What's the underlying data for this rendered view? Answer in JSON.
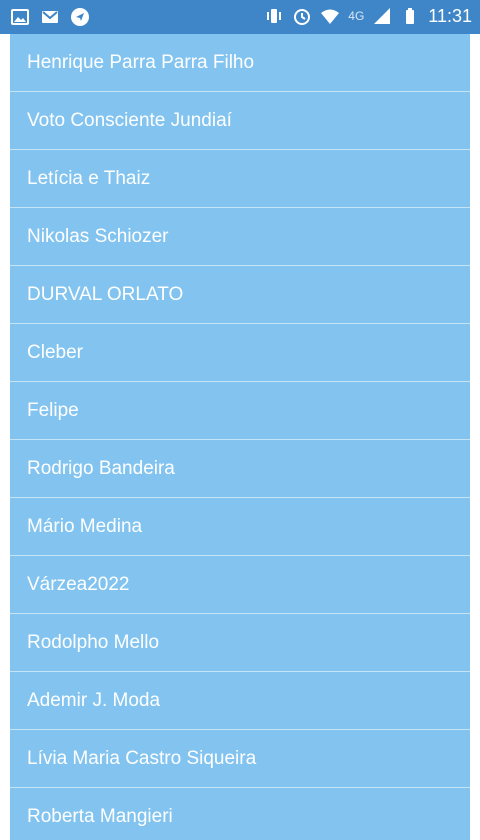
{
  "status_bar": {
    "time": "11:31",
    "network": "4G",
    "left_icons": [
      "image-icon",
      "gmail-icon",
      "navigation-icon"
    ],
    "right_icons": [
      "vibrate-icon",
      "alarm-icon",
      "wifi-icon",
      "signal-icon",
      "battery-icon"
    ]
  },
  "colors": {
    "status_bar": "#3f86c8",
    "list_item": "#82c4ef",
    "text": "#ffffff"
  },
  "contacts": [
    "Henrique Parra Parra Filho",
    "Voto Consciente Jundiaí",
    "Letícia e Thaiz",
    "Nikolas Schiozer",
    "DURVAL ORLATO",
    "Cleber",
    "Felipe",
    "Rodrigo Bandeira",
    "Mário Medina",
    "Várzea2022",
    "Rodolpho Mello",
    "Ademir J. Moda",
    "Lívia Maria Castro Siqueira",
    "Roberta Mangieri"
  ]
}
